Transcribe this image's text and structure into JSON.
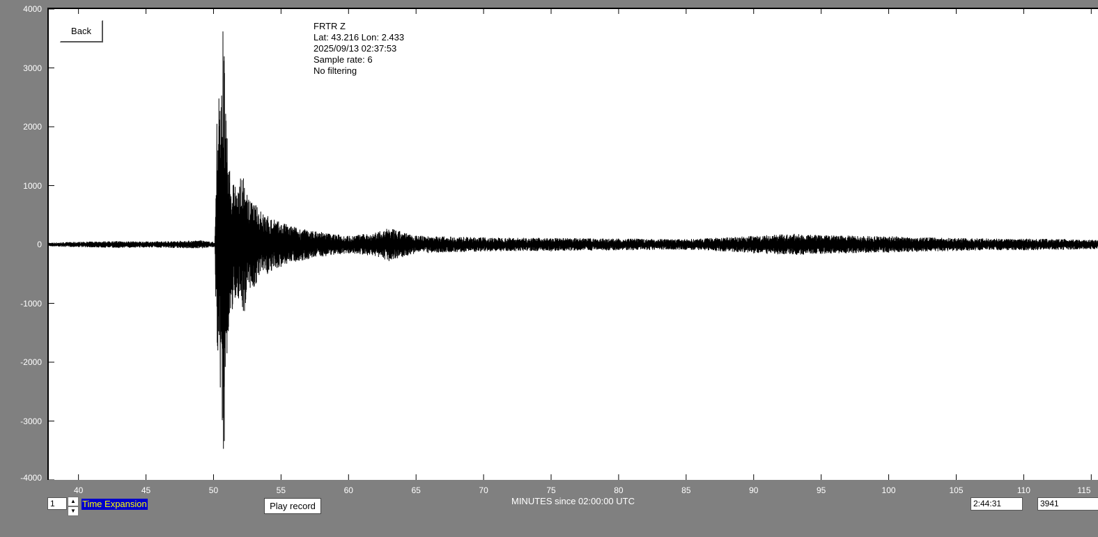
{
  "back_button": "Back",
  "info": {
    "station": "FRTR  Z",
    "location": "Lat: 43.216 Lon: 2.433",
    "datetime": "2025/09/13 02:37:53",
    "sample_rate": "Sample rate: 6",
    "filter": "No filtering"
  },
  "controls": {
    "expansion_value": "1",
    "expansion_label": "Time Expansion",
    "play_label": "Play record",
    "time_readout": "2:44:31",
    "value_readout": "3941"
  },
  "colors": {
    "background": "#808080",
    "plot": "#ffffff",
    "trace": "#000000",
    "label": "#ffff00",
    "label_bg": "#0000cc"
  },
  "icons": {
    "spin_up": "up-arrow-icon",
    "spin_down": "down-arrow-icon"
  },
  "chart_data": {
    "type": "line",
    "xlabel": "MINUTES since 02:00:00 UTC",
    "ylabel": "",
    "xlim": [
      37.8,
      115.5
    ],
    "ylim": [
      -4000,
      4000
    ],
    "x_ticks": [
      40,
      45,
      50,
      55,
      60,
      65,
      70,
      75,
      80,
      85,
      90,
      95,
      100,
      105,
      110,
      115
    ],
    "x_tick_labels": [
      "40",
      "45",
      "50",
      "55",
      "60",
      "65",
      "70",
      "75",
      "80",
      "85",
      "90",
      "95",
      "100",
      "105",
      "110",
      "115"
    ],
    "y_ticks": [
      4000,
      3000,
      2000,
      1000,
      0,
      -1000,
      -2000,
      -3000,
      -4000
    ],
    "y_tick_labels": [
      "4000",
      "3000",
      "2000",
      "1000",
      "0",
      "-1000",
      "-2000",
      "-3000",
      "-4000"
    ],
    "grid": false,
    "series": [
      {
        "name": "",
        "x": [
          37.8,
          39,
          41,
          43,
          45,
          47,
          49,
          50.1,
          50.25,
          50.32,
          50.4,
          50.5,
          50.6,
          50.7,
          50.8,
          50.9,
          51.0,
          51.2,
          51.4,
          51.6,
          51.8,
          52.0,
          52.3,
          52.6,
          53.0,
          53.5,
          54.0,
          54.5,
          55.0,
          56.0,
          57.0,
          58.0,
          60.0,
          62.0,
          63.0,
          65.0,
          70.0,
          75.0,
          80.0,
          85.0,
          88.0,
          90.0,
          93.0,
          95.0,
          97.0,
          100.0,
          103.0,
          105.0,
          108.0,
          110.0,
          113.0,
          115.5
        ],
        "y": [
          30,
          -40,
          50,
          -60,
          50,
          -60,
          70,
          -40,
          2050,
          -1800,
          2480,
          -2430,
          2530,
          3620,
          -3340,
          2220,
          -1850,
          1250,
          -1100,
          980,
          -880,
          1120,
          -1130,
          760,
          -720,
          560,
          -500,
          420,
          -380,
          300,
          -250,
          210,
          -150,
          200,
          -280,
          150,
          120,
          -110,
          100,
          -90,
          120,
          -150,
          180,
          -160,
          150,
          -140,
          120,
          -110,
          100,
          -100,
          90,
          80
        ]
      }
    ]
  }
}
